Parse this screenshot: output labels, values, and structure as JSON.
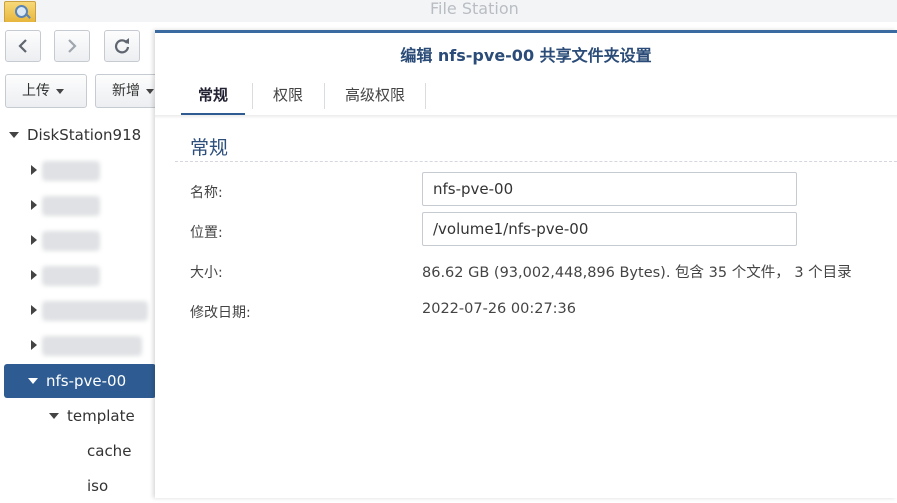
{
  "window": {
    "title": "File Station"
  },
  "toolbar": {
    "back_icon": "chevron-left-icon",
    "forward_icon": "chevron-right-icon",
    "refresh_icon": "refresh-icon",
    "upload_label": "上传",
    "new_label": "新增"
  },
  "tree": {
    "root_label": "DiskStation918",
    "selected_label": "nfs-pve-00",
    "children": [
      {
        "label": "template"
      },
      {
        "label": "cache"
      },
      {
        "label": "iso"
      }
    ]
  },
  "dialog": {
    "title": "编辑 nfs-pve-00 共享文件夹设置",
    "tabs": [
      {
        "label": "常规",
        "active": true
      },
      {
        "label": "权限",
        "active": false
      },
      {
        "label": "高级权限",
        "active": false
      }
    ],
    "section_title": "常规",
    "fields": {
      "name_label": "名称:",
      "name_value": "nfs-pve-00",
      "location_label": "位置:",
      "location_value": "/volume1/nfs-pve-00",
      "size_label": "大小:",
      "size_value": "86.62 GB (93,002,448,896 Bytes). 包含 35 个文件，  3 个目录",
      "modified_label": "修改日期:",
      "modified_value": "2022-07-26 00:27:36"
    }
  },
  "colors": {
    "selection": "#2e5c92",
    "dialog_title": "#2b4c78",
    "accent_border": "#3b6aa0"
  }
}
